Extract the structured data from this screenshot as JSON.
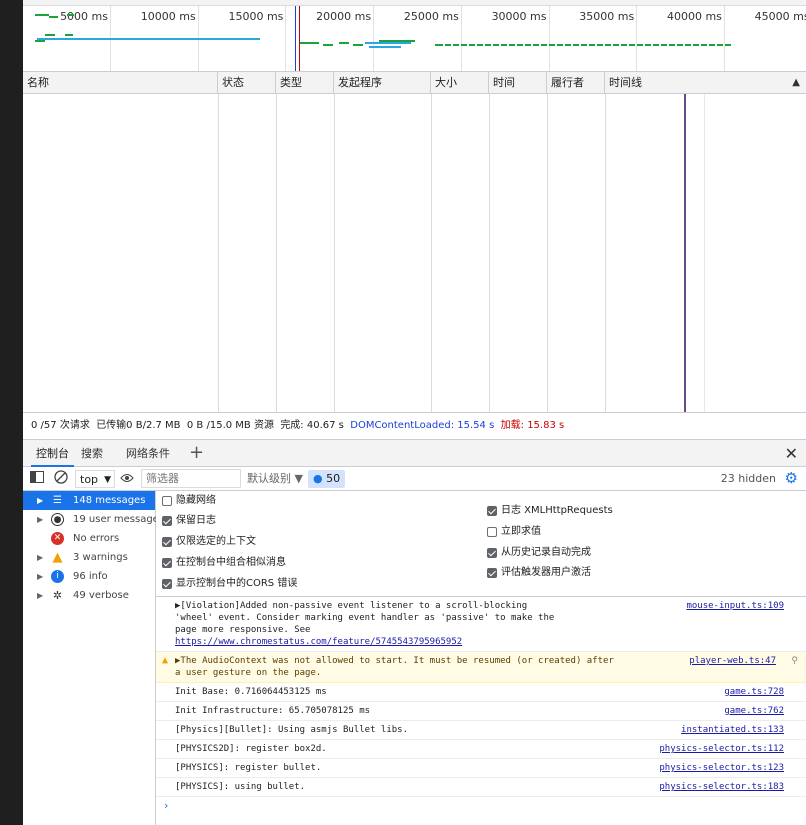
{
  "overview": {
    "ticks": [
      "5000 ms",
      "10000 ms",
      "15000 ms",
      "20000 ms",
      "25000 ms",
      "30000 ms",
      "35000 ms",
      "40000 ms",
      "45000 ms"
    ]
  },
  "table": {
    "columns": [
      "名称",
      "状态",
      "类型",
      "发起程序",
      "大小",
      "时间",
      "履行者",
      "时间线"
    ],
    "sort_arrow": "▲"
  },
  "status": {
    "requests": "0 /57 次请求",
    "transferred": "已传输0 B/2.7 MB",
    "resources": "0 B /15.0 MB 资源",
    "finish": "完成: 40.67 s",
    "dcl": "DOMContentLoaded: 15.54 s",
    "load": "加载: 15.83 s"
  },
  "drawer": {
    "tabs": [
      "控制台",
      "搜索",
      "网络条件"
    ],
    "add": "+",
    "close": "✕"
  },
  "toolbar": {
    "context": "top",
    "filter_placeholder": "筛选器",
    "levels": "默认级别 ▼",
    "message_count": "50",
    "hidden": "23 hidden"
  },
  "sidebar": {
    "items": [
      {
        "label": "148 messages"
      },
      {
        "label": "19 user messages"
      },
      {
        "label": "No errors"
      },
      {
        "label": "3 warnings"
      },
      {
        "label": "96 info"
      },
      {
        "label": "49 verbose"
      }
    ]
  },
  "settings": {
    "left": [
      {
        "label": "隐藏网络",
        "checked": false
      },
      {
        "label": "保留日志",
        "checked": true
      },
      {
        "label": "仅限选定的上下文",
        "checked": true
      },
      {
        "label": "在控制台中组合相似消息",
        "checked": true
      },
      {
        "label": "显示控制台中的CORS 错误",
        "checked": true
      }
    ],
    "right": [
      {
        "label": "日志 XMLHttpRequests",
        "checked": true
      },
      {
        "label": "立即求值",
        "checked": false
      },
      {
        "label": "从历史记录自动完成",
        "checked": true
      },
      {
        "label": "评估触发器用户激活",
        "checked": true
      }
    ]
  },
  "messages": [
    {
      "type": "violation",
      "text": "▶[Violation]Added non-passive event listener to a scroll-blocking 'wheel' event. Consider marking event handler as 'passive' to make the page more responsive. See ",
      "link": "https://www.chromestatus.com/feature/5745543795965952",
      "source": "mouse-input.ts:109"
    },
    {
      "type": "warn",
      "text": "▶The AudioContext was not allowed to start. It must be resumed (or created) after a user gesture on the page.",
      "source": "player-web.ts:47"
    },
    {
      "type": "log",
      "text": "Init Base: 0.716064453125 ms",
      "source": "game.ts:728"
    },
    {
      "type": "log",
      "text": "Init Infrastructure: 65.705078125 ms",
      "source": "game.ts:762"
    },
    {
      "type": "log",
      "text": "[Physics][Bullet]: Using asmjs Bullet libs.",
      "source": "instantiated.ts:133"
    },
    {
      "type": "log",
      "text": "[PHYSICS2D]: register box2d.",
      "source": "physics-selector.ts:112"
    },
    {
      "type": "log",
      "text": "[PHYSICS]: register bullet.",
      "source": "physics-selector.ts:123"
    },
    {
      "type": "log",
      "text": "[PHYSICS]: using bullet.",
      "source": "physics-selector.ts:183"
    }
  ],
  "prompt": "›",
  "colors": {
    "accent": "#1a73e8",
    "waterfall_blue": "#2aa7e0",
    "waterfall_green": "#1aa33a",
    "dcl_line": "#1a3fd6",
    "load_line": "#c80000",
    "warning_bg": "#fffbe5"
  }
}
